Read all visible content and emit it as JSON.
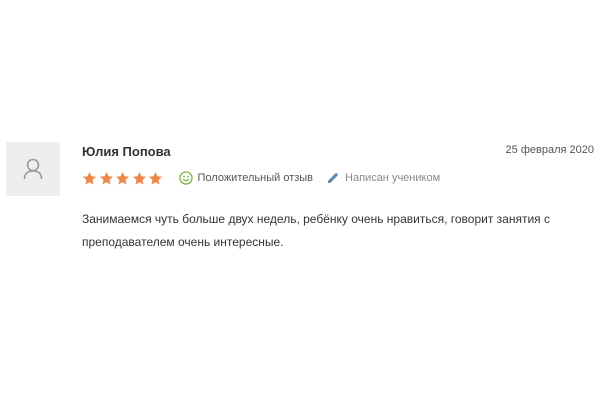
{
  "review": {
    "author": "Юлия Попова",
    "date": "25 февраля 2020",
    "rating": 5,
    "rating_max": 5,
    "positive_label": "Положительный отзыв",
    "written_by_label": "Написан учеником",
    "text": "Занимаемся чуть больше двух недель, ребёнку очень нравиться, говорит занятия с преподавателем очень интересные.",
    "icons": {
      "avatar": "user-icon",
      "star": "star-icon",
      "positive": "smiley-icon",
      "written_by": "pencil-icon"
    },
    "colors": {
      "star": "#f0874a",
      "smiley": "#7cb342",
      "pencil": "#5b8db8",
      "avatar_bg": "#eeeeee",
      "avatar_icon": "#999999"
    }
  }
}
